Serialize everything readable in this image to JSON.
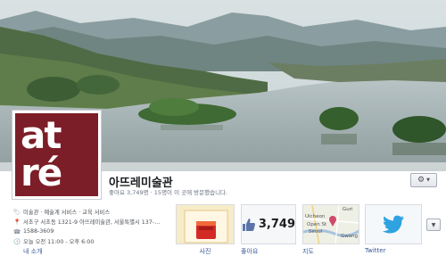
{
  "page": {
    "name": "아뜨레미술관",
    "stats": "좋아요 3,749명 · 15명이 이 곳에 방문했습니다."
  },
  "profile": {
    "logo_line1": "at",
    "logo_line2": "ré",
    "colors": {
      "logo_bg": "#7c1e28",
      "logo_text": "#ffffff"
    }
  },
  "info": {
    "category": "미술관 · 예술계 서비스 · 교육 서비스",
    "address": "서초구 서초동 1321-9 아뜨레미술관, 서울특별시 137-…",
    "phone": "1588-3609",
    "hours": "오늘 오전 11:00 - 오후 6:00",
    "about_link": "내 소개"
  },
  "tiles": {
    "photos_label": "사진",
    "likes_count": "3,749",
    "likes_label": "좋아요",
    "map_label": "지도",
    "twitter_label": "Twitter",
    "map_places": [
      "Guri",
      "Uicheon",
      "Open St",
      "Seoul",
      "Gwang"
    ]
  },
  "icons": {
    "gear": "gear-icon",
    "like": "thumbs-up-icon",
    "twitter": "twitter-bird-icon",
    "more": "chevron-down-icon"
  },
  "colors": {
    "link": "#3b5998",
    "twitter_blue": "#2fa3e0"
  }
}
